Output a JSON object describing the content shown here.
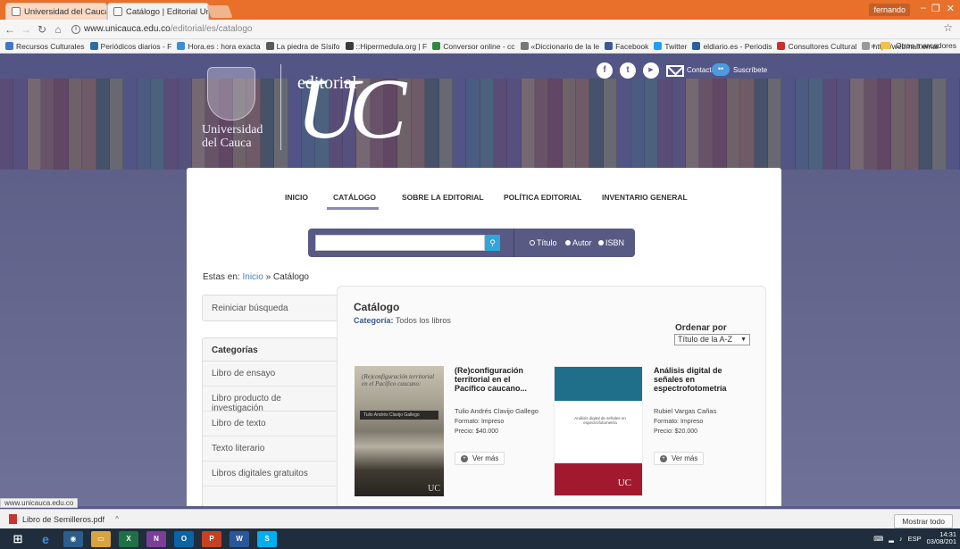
{
  "browser": {
    "tabs": [
      {
        "title": "Universidad del Cauca |",
        "close": "×"
      },
      {
        "title": "Catálogo | Editorial Unic",
        "close": "×"
      }
    ],
    "user": "fernando",
    "address": {
      "domain": "www.unicauca.edu.co",
      "path": "/editorial/es/catalogo"
    },
    "bookmarks": [
      {
        "label": "Recursos Culturales",
        "color": "#3c78c8"
      },
      {
        "label": "Periódicos diarios - F",
        "color": "#2a6ea8"
      },
      {
        "label": "Hora.es : hora exacta",
        "color": "#3a8fd6"
      },
      {
        "label": "La piedra de Sísifo",
        "color": "#5a5a5a"
      },
      {
        "label": "::Hipermedula.org | F",
        "color": "#3a3a3a"
      },
      {
        "label": "Conversor online - cc",
        "color": "#2d8a3e"
      },
      {
        "label": "«Diccionario de la le",
        "color": "#777777"
      },
      {
        "label": "Facebook",
        "color": "#3b5998"
      },
      {
        "label": "Twitter",
        "color": "#1da1f2"
      },
      {
        "label": "eldiario.es - Periodis",
        "color": "#2b5f9e"
      },
      {
        "label": "Consultores Cultural",
        "color": "#c9302c"
      },
      {
        "label": "http://webmail.emai",
        "color": "#999999"
      }
    ],
    "bookmarks_more": "»",
    "other_bookmarks": "Otros marcadores",
    "status_url": "www.unicauca.edu.co"
  },
  "header": {
    "university": "Universidad\ndel Cauca",
    "editorial": "editorial",
    "brand": "UC",
    "social": [
      {
        "label": "f",
        "name": "facebook-icon"
      },
      {
        "label": "t",
        "name": "twitter-icon"
      },
      {
        "label": "▶",
        "name": "youtube-icon"
      }
    ],
    "contact": "Contacto",
    "subscribe": "Suscríbete"
  },
  "nav": {
    "items": [
      "INICIO",
      "CATÁLOGO",
      "SOBRE LA EDITORIAL",
      "POLÍTICA EDITORIAL",
      "INVENTARIO GENERAL"
    ]
  },
  "search": {
    "placeholder": "",
    "options": [
      "Título",
      "Autor",
      "ISBN"
    ]
  },
  "breadcrumb": {
    "prefix": "Estas en:",
    "home": "Inicio",
    "sep": "»",
    "current": "Catálogo"
  },
  "sidebar": {
    "reset": "Reiniciar búsqueda",
    "categories_title": "Categorías",
    "categories": [
      "Libro de ensayo",
      "Libro producto de investigación",
      "Libro de texto",
      "Texto literario",
      "Libros digitales gratuitos"
    ]
  },
  "catalog": {
    "title": "Catálogo",
    "category_label": "Categoría:",
    "category_value": "Todos los libros",
    "sort_label": "Ordenar por",
    "sort_value": "Título de la A-Z",
    "books": [
      {
        "title": "(Re)configuración territorial en el Pacífico caucano...",
        "author": "Tulio Andrés Clavijo Gallego",
        "format": "Formato: Impreso",
        "price": "Precio: $40.000",
        "button": "Ver más",
        "cover_title": "(Re)configuración territorial en el Pacífico caucano:",
        "cover_author": "Tulio Andrés Clavijo Gallego",
        "cover_logo": "UC"
      },
      {
        "title": "Análisis digital de señales en espectrofotometría",
        "author": "Rubiel Vargas Cañas",
        "format": "Formato: Impreso",
        "price": "Precio: $20.000",
        "button": "Ver más",
        "cover_title": "Análisis digital de señales en espectrofotometría",
        "cover_logo": "UC"
      }
    ]
  },
  "downloads": {
    "file": "Libro de Semilleros.pdf",
    "show_all": "Mostrar todo"
  },
  "taskbar": {
    "lang": "ESP",
    "time": "14:31",
    "date": "03/08/201"
  }
}
